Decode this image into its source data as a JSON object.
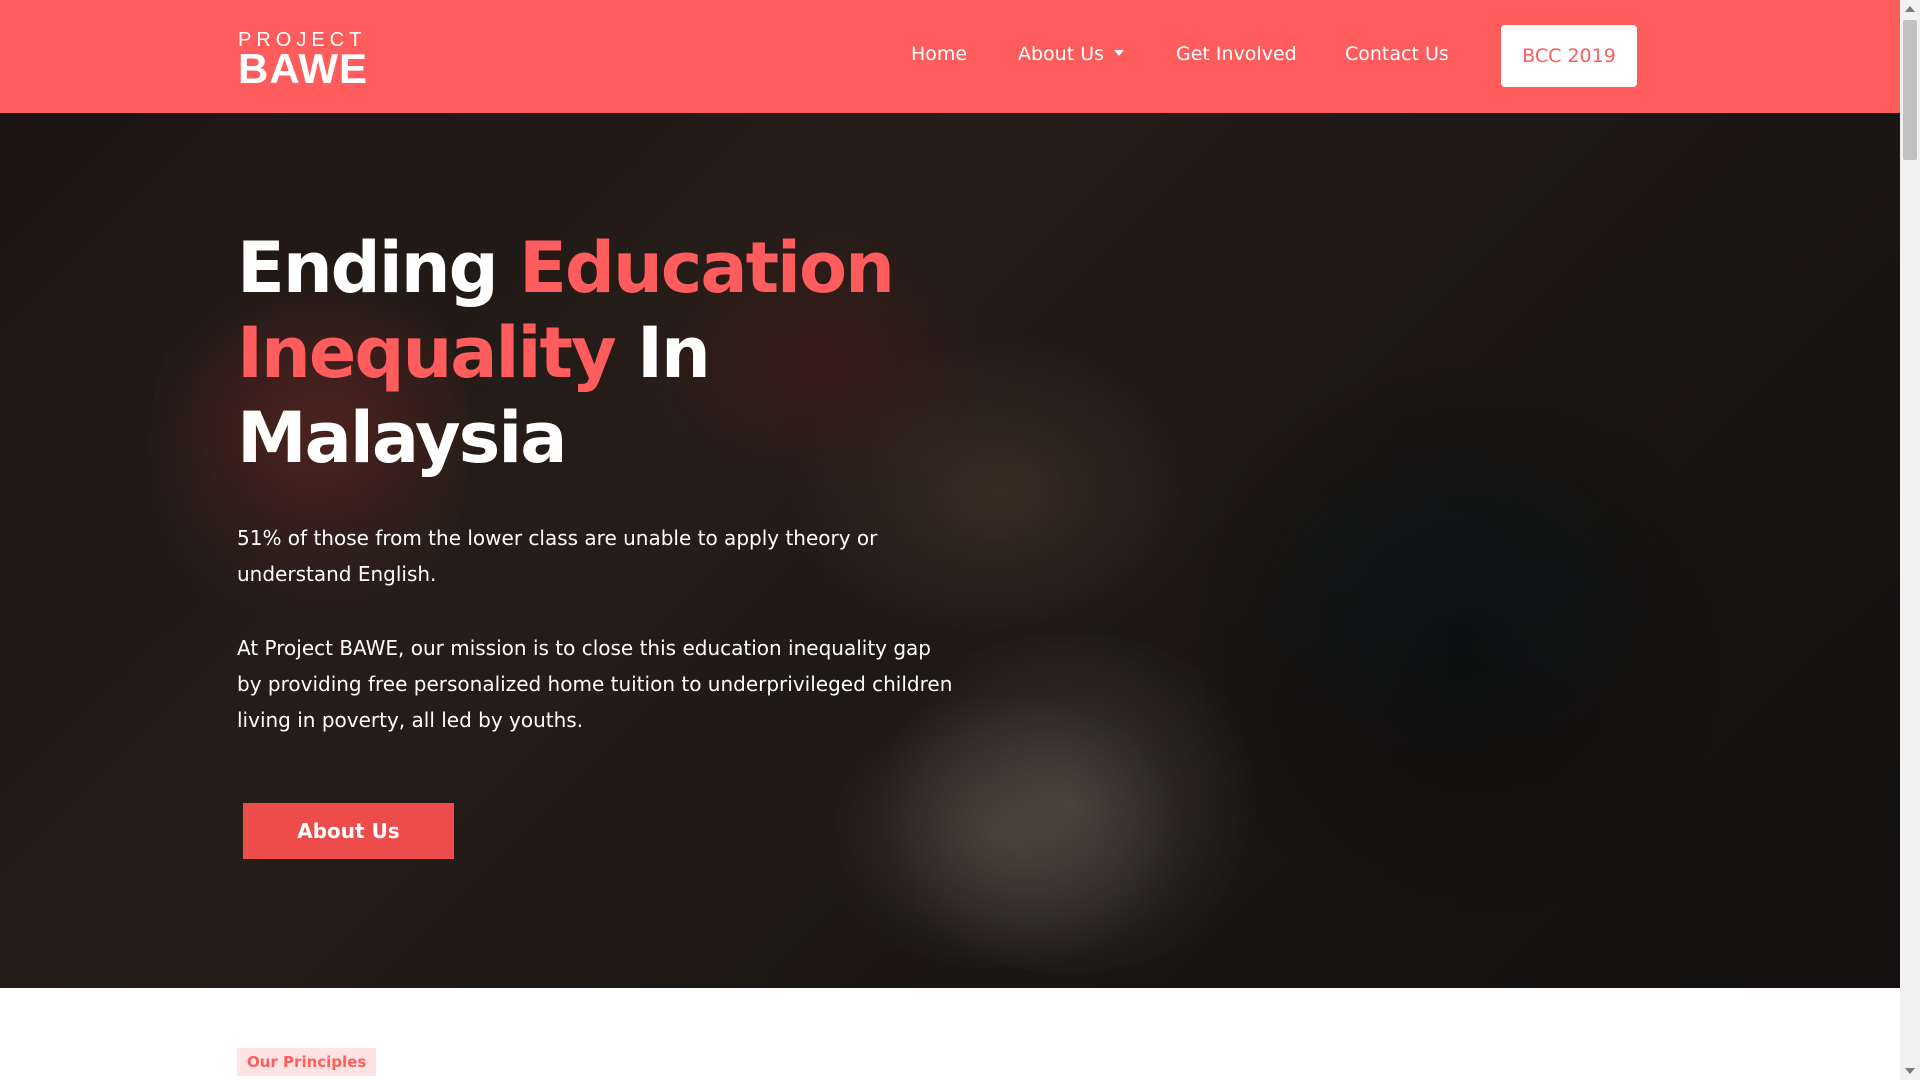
{
  "navbar": {
    "logo_small": "PROJECT",
    "logo_big": "BAWE",
    "links": [
      "Home",
      "About Us",
      "Get Involved",
      "Contact Us"
    ],
    "cta": "BCC 2019"
  },
  "hero": {
    "title_part1": "Ending ",
    "title_accent": "Education Inequality",
    "title_part2": " In Malaysia",
    "paragraph1": "51% of those from the lower class are unable to apply theory or understand English.",
    "paragraph2": "At Project BAWE, our mission is to close this education inequality gap by providing free personalized home tuition to underprivileged children living in poverty, all led by youths.",
    "button": "About Us"
  },
  "principles": {
    "tag": "Our Principles"
  },
  "colors": {
    "accent": "#ff5d5d",
    "button": "#ee4b4b"
  },
  "icons": [
    "chevron-down-icon"
  ]
}
